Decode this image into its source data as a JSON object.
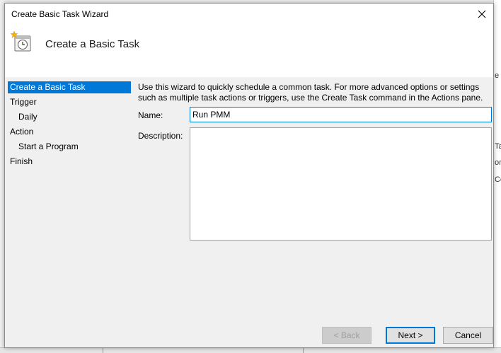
{
  "window": {
    "title": "Create Basic Task Wizard",
    "close_icon": "close-icon"
  },
  "header": {
    "title": "Create a Basic Task",
    "icon": "task-scheduler-icon"
  },
  "steps": [
    {
      "label": "Create a Basic Task",
      "active": true
    },
    {
      "label": "Trigger"
    },
    {
      "label": "Daily"
    },
    {
      "label": "Action"
    },
    {
      "label": "Start a Program"
    },
    {
      "label": "Finish"
    }
  ],
  "content": {
    "intro_line1": "Use this wizard to quickly schedule a common task.  For more advanced options or settings",
    "intro_line2": "such as multiple task actions or triggers, use the Create Task command in the Actions pane.",
    "name_label": "Name:",
    "name_value": "Run PMM",
    "description_label": "Description:",
    "description_value": ""
  },
  "buttons": {
    "back": "< Back",
    "next": "Next >",
    "cancel": "Cancel"
  },
  "background": {
    "edge_chars": [
      "Ta",
      "or",
      "Co",
      "e"
    ]
  },
  "colors": {
    "accent": "#0078d7",
    "dialog_bg": "#f0f0f0"
  }
}
